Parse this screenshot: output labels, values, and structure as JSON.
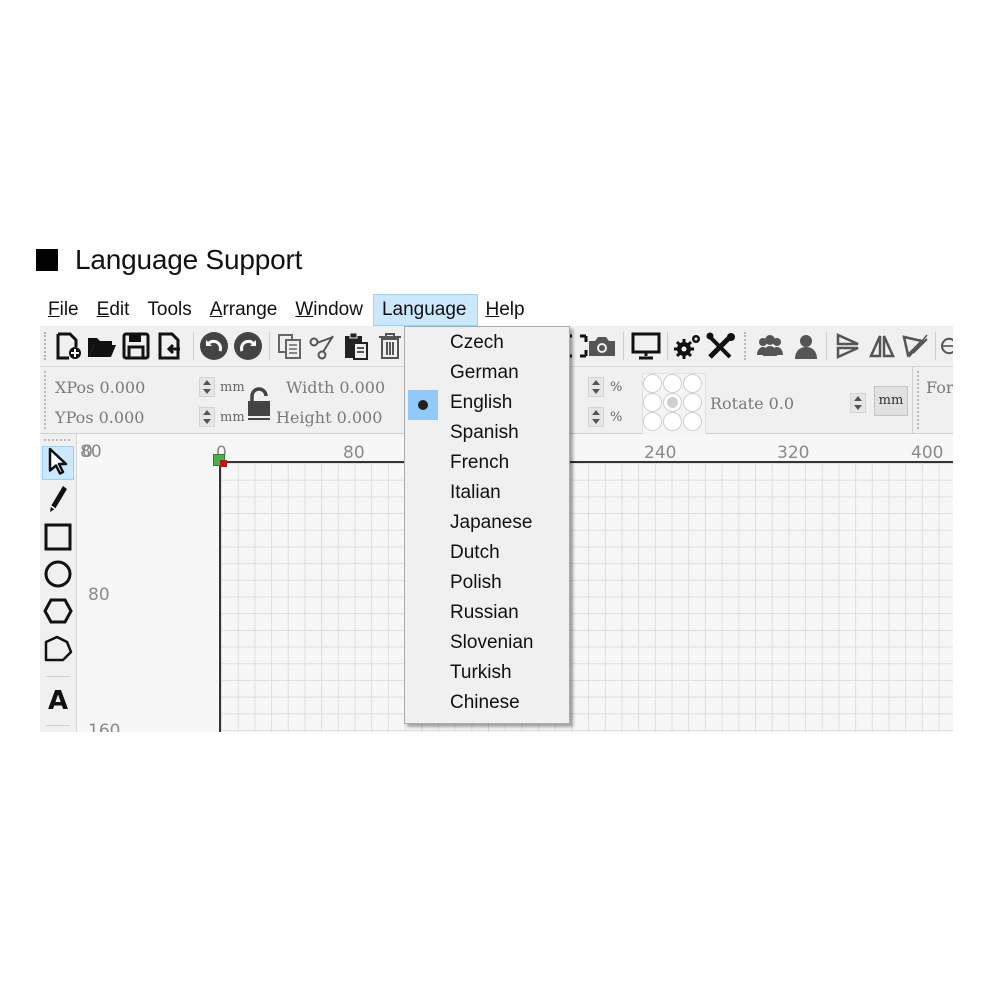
{
  "heading": {
    "title": "Language Support"
  },
  "menubar": {
    "items": [
      {
        "label": "File",
        "mnemonic": "F",
        "rest": "ile"
      },
      {
        "label": "Edit",
        "mnemonic": "E",
        "rest": "dit"
      },
      {
        "label": "Tools",
        "mnemonic": "",
        "rest": "Tools"
      },
      {
        "label": "Arrange",
        "mnemonic": "A",
        "rest": "rrange"
      },
      {
        "label": "Window",
        "mnemonic": "W",
        "rest": "indow"
      },
      {
        "label": "Language",
        "mnemonic": "",
        "rest": "Language",
        "active": true
      },
      {
        "label": "Help",
        "mnemonic": "H",
        "rest": "elp"
      }
    ]
  },
  "toolbar": {
    "icons": [
      "new-file-icon",
      "open-folder-icon",
      "save-icon",
      "import-icon",
      "undo-icon",
      "redo-icon",
      "copy-icon",
      "cut-icon",
      "paste-icon",
      "delete-icon",
      "select-frame-icon",
      "camera-icon",
      "monitor-icon",
      "settings-icon",
      "tools-icon",
      "users-icon",
      "user-icon",
      "flip-vertical-icon",
      "flip-horizontal-icon",
      "mirror-diagonal-icon"
    ]
  },
  "properties": {
    "xpos_label": "XPos",
    "xpos_value": "0.000",
    "ypos_label": "YPos",
    "ypos_value": "0.000",
    "width_label": "Width",
    "width_value": "0.000",
    "height_label": "Height",
    "height_value": "0.000",
    "unit_mm": "mm",
    "unit_percent": "%",
    "rotate_label": "Rotate",
    "rotate_value": "0.0",
    "unit_button": "mm",
    "font_label": "For"
  },
  "left_tools": [
    "select-tool",
    "pencil-tool",
    "rectangle-tool",
    "ellipse-tool",
    "polygon-tool",
    "polyline-tool",
    "text-tool"
  ],
  "rulers": {
    "top": [
      "0",
      "80",
      "240",
      "320",
      "400"
    ],
    "left": [
      "0",
      "80",
      "160"
    ],
    "corner_overlap": "80"
  },
  "language_menu": {
    "selected": "English",
    "items": [
      "Czech",
      "German",
      "English",
      "Spanish",
      "French",
      "Italian",
      "Japanese",
      "Dutch",
      "Polish",
      "Russian",
      "Slovenian",
      "Turkish",
      "Chinese"
    ]
  },
  "colors": {
    "menu_highlight": "#cce8ff",
    "selected_check_bg": "#91c9f7",
    "origin_green": "#4caf50",
    "origin_red": "#b71c1c"
  }
}
